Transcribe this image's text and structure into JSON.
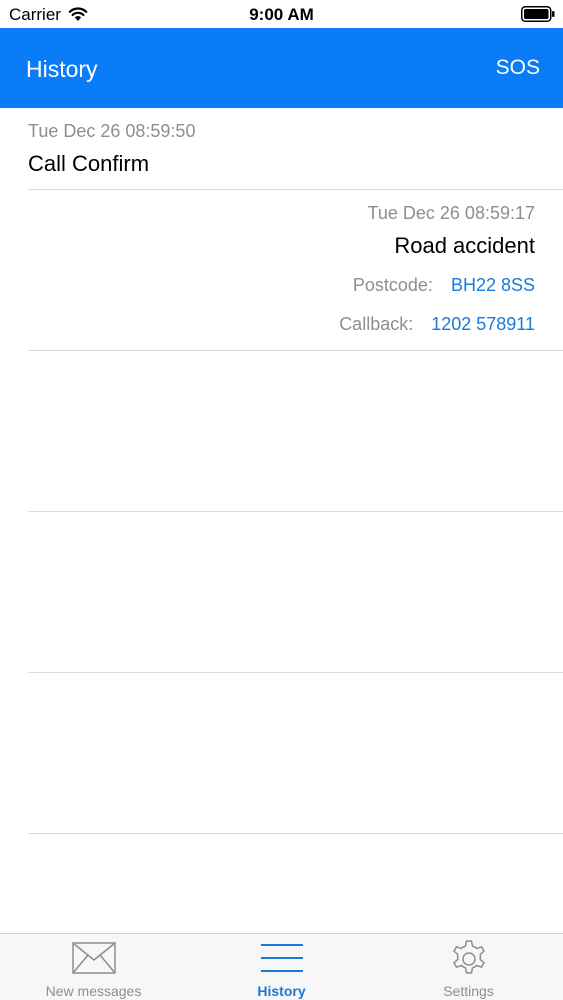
{
  "status_bar": {
    "carrier": "Carrier",
    "time": "9:00 AM",
    "wifi_icon": "wifi-icon",
    "battery_icon": "battery-icon"
  },
  "nav": {
    "title": "History",
    "sos_label": "SOS",
    "background_color": "#0a7cf7"
  },
  "history": {
    "incoming": {
      "timestamp": "Tue Dec 26 08:59:50",
      "message": "Call Confirm"
    },
    "outgoing": {
      "timestamp": "Tue Dec 26 08:59:17",
      "message": "Road accident",
      "postcode_label": "Postcode:",
      "postcode_value": "BH22 8SS",
      "callback_label": "Callback:",
      "callback_value": "1202 578911"
    }
  },
  "tab_bar": {
    "tabs": [
      {
        "label": "New messages",
        "icon": "envelope-icon",
        "active": false
      },
      {
        "label": "History",
        "icon": "list-icon",
        "active": true
      },
      {
        "label": "Settings",
        "icon": "gear-icon",
        "active": false
      }
    ],
    "active_color": "#1a7ad8",
    "inactive_color": "#8e8e8e"
  }
}
